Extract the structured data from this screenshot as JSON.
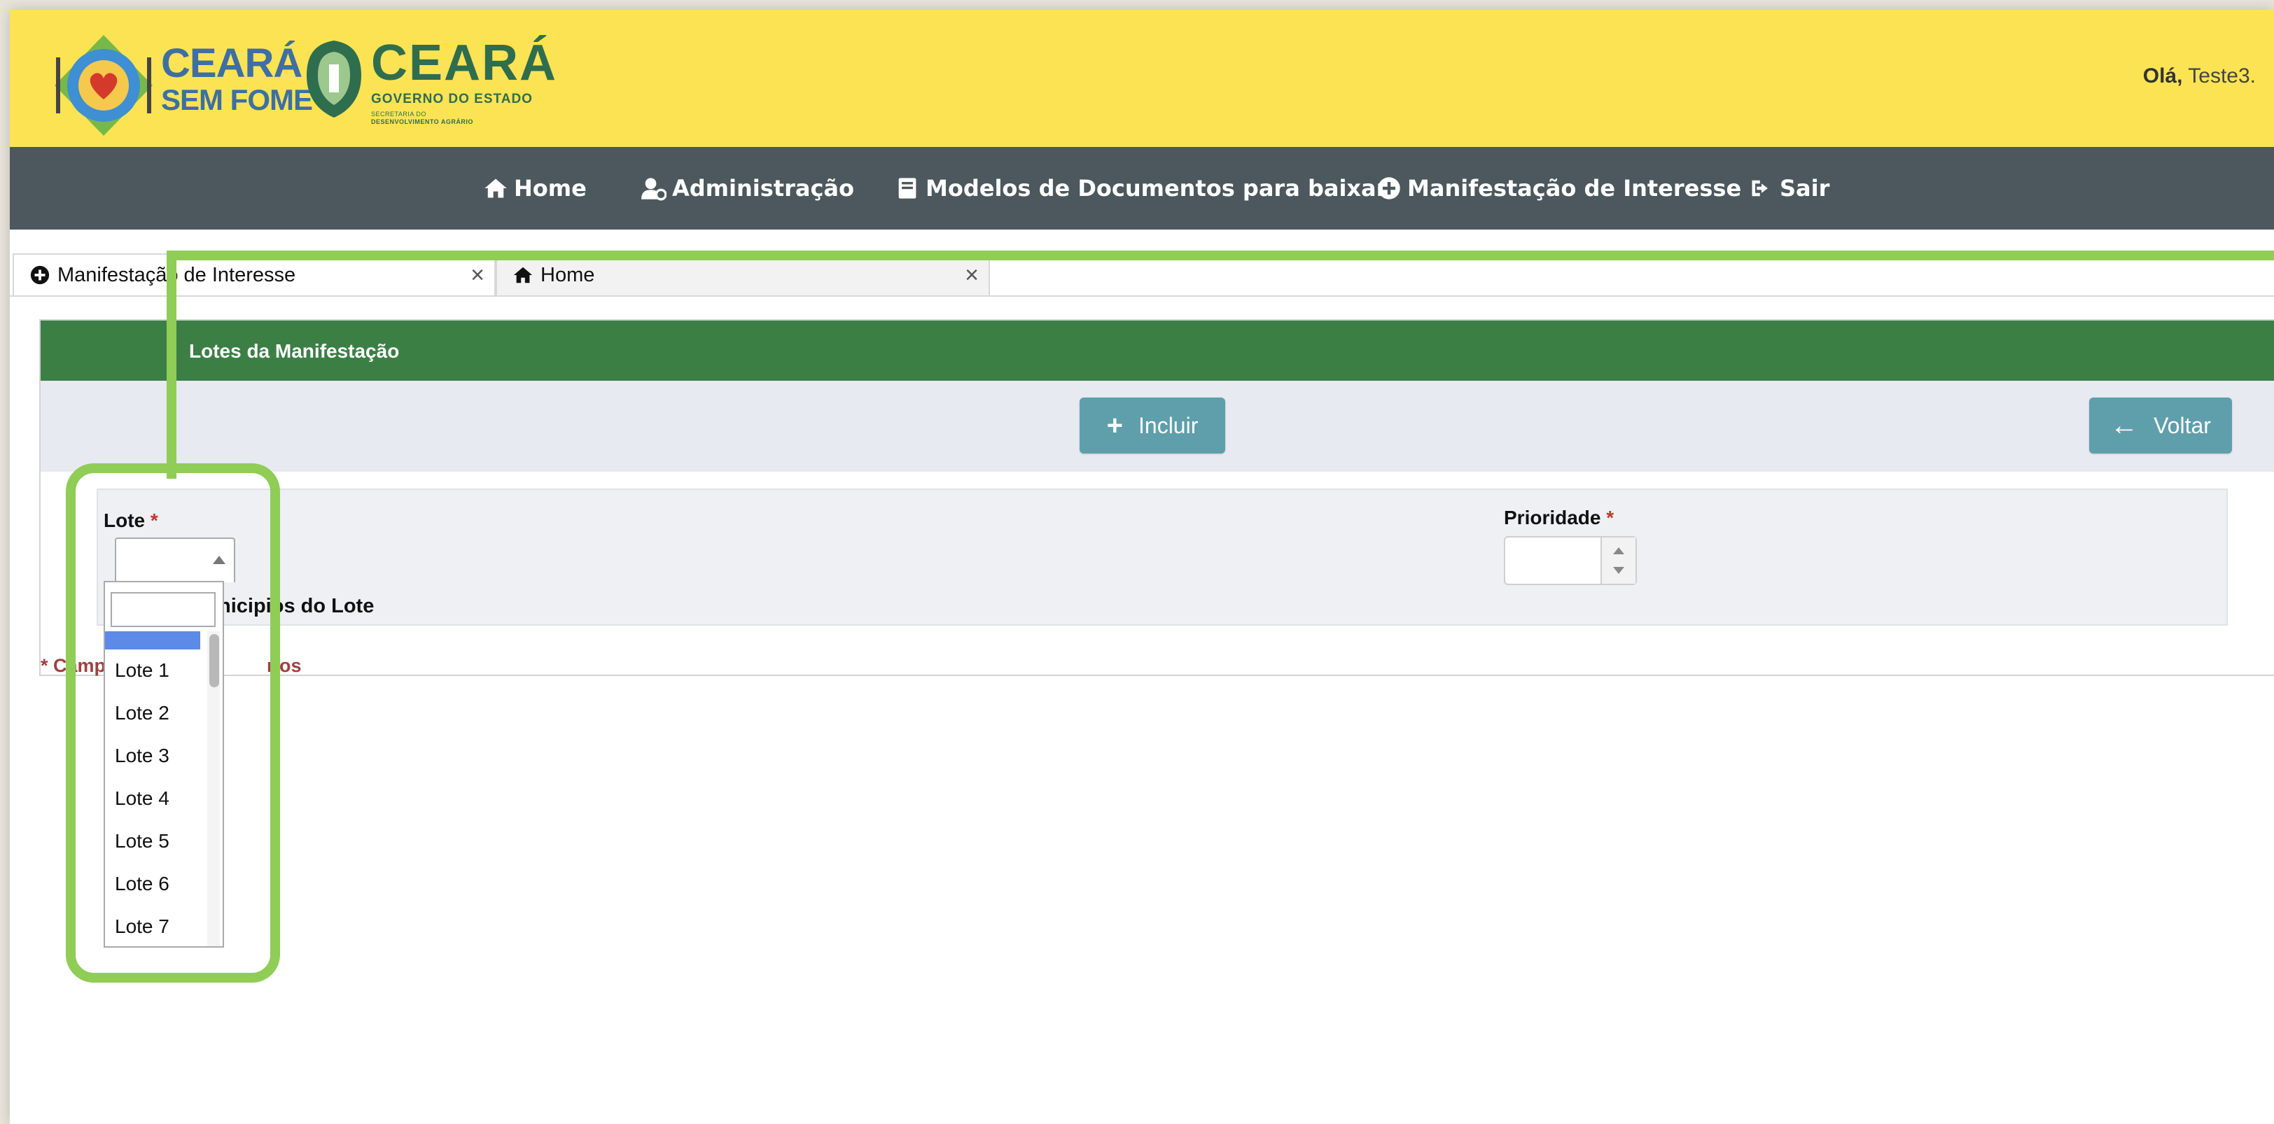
{
  "header": {
    "brand_line1": "CEARÁ",
    "brand_line2": "SEM FOME",
    "gov_title": "CEARÁ",
    "gov_subtitle": "GOVERNO DO ESTADO",
    "gov_line3": "SECRETARIA DO",
    "gov_line4": "DESENVOLVIMENTO AGRÁRIO",
    "greeting_bold": "Olá,",
    "greeting_user": "Teste3."
  },
  "nav": [
    {
      "label": "Home",
      "icon": "home-icon"
    },
    {
      "label": "Administração",
      "icon": "user-gear-icon"
    },
    {
      "label": "Modelos de Documentos para baixar",
      "icon": "book-icon"
    },
    {
      "label": "Manifestação de Interesse",
      "icon": "plus-circle-icon"
    },
    {
      "label": "Sair",
      "icon": "sign-out-icon"
    }
  ],
  "tabs": [
    {
      "label": "Manifestação de Interesse",
      "icon": "plus-circle-icon",
      "active": true
    },
    {
      "label": "Home",
      "icon": "home-icon",
      "active": false
    }
  ],
  "panel": {
    "title": "Lotes da Manifestação",
    "include_label": "Incluir",
    "back_label": "Voltar",
    "lote_label": "Lote",
    "prioridade_label": "Prioridade",
    "required_mark": "*",
    "municipios_label": "nicipios do Lote",
    "required_note": "* Camp",
    "required_note_end": "rios"
  },
  "dropdown": {
    "search_value": "",
    "options": [
      "",
      "Lote 1",
      "Lote 2",
      "Lote 3",
      "Lote 4",
      "Lote 5",
      "Lote 6",
      "Lote 7"
    ]
  },
  "colors": {
    "header_bg": "#fce354",
    "nav_bg": "#4c585d",
    "panel_head_bg": "#3b7f45",
    "button_bg": "#5e9fab",
    "annotation": "#8fcd56",
    "selection": "#5c8ae6"
  }
}
